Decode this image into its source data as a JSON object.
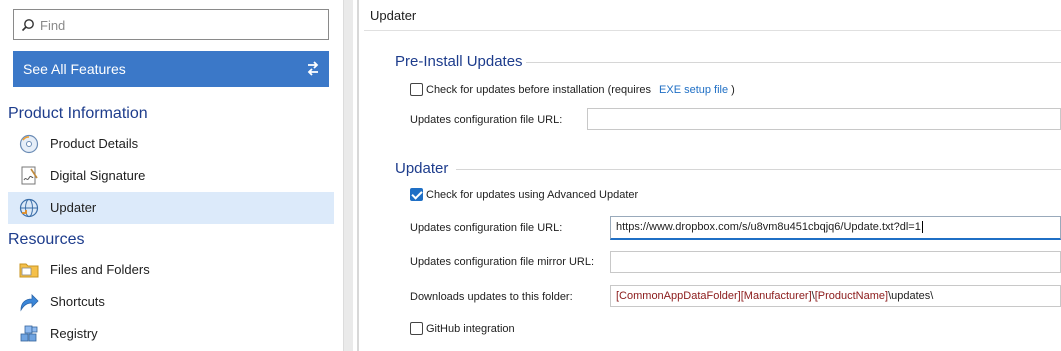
{
  "search": {
    "placeholder": "Find"
  },
  "see_all": {
    "label": "See All Features"
  },
  "sections": [
    {
      "title": "Product Information",
      "items": [
        {
          "label": "Product Details",
          "icon": "disc-icon"
        },
        {
          "label": "Digital Signature",
          "icon": "signature-icon"
        },
        {
          "label": "Updater",
          "icon": "globe-update-icon",
          "selected": true
        }
      ]
    },
    {
      "title": "Resources",
      "items": [
        {
          "label": "Files and Folders",
          "icon": "folder-icon"
        },
        {
          "label": "Shortcuts",
          "icon": "shortcut-arrow-icon"
        },
        {
          "label": "Registry",
          "icon": "registry-cubes-icon"
        }
      ]
    }
  ],
  "main": {
    "title": "Updater",
    "pre_install": {
      "header": "Pre-Install Updates",
      "check_label": "Check for updates before installation (requires",
      "check_link": "EXE setup file",
      "check_suffix": ")",
      "check_checked": false,
      "config_url_label": "Updates configuration file URL:",
      "config_url_value": ""
    },
    "updater": {
      "header": "Updater",
      "check_label": "Check for updates using Advanced Updater",
      "check_checked": true,
      "config_url_label": "Updates configuration file URL:",
      "config_url_value": "https://www.dropbox.com/s/u8vm8u451cbqjq6/Update.txt?dl=1",
      "mirror_url_label": "Updates configuration file mirror URL:",
      "mirror_url_value": "",
      "download_label": "Downloads updates to this folder:",
      "download_tokens": [
        "[CommonAppDataFolder]",
        "[Manufacturer]",
        "\\",
        "[ProductName]",
        "\\updates\\"
      ],
      "github_label": "GitHub integration",
      "github_checked": false
    }
  },
  "colors": {
    "accent": "#3b78c8",
    "header_blue": "#1d3c8c",
    "selected_bg": "#dceafa",
    "token_red": "#8b1a1a",
    "link_blue": "#1f6fc5"
  }
}
